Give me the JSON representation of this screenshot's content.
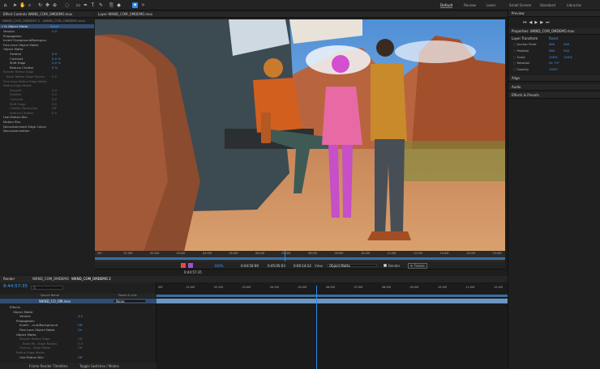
{
  "toolbar": {
    "workspaces": [
      "Default",
      "Review",
      "Learn",
      "Small Screen",
      "Standard",
      "Libraries"
    ],
    "active_workspace": "Default"
  },
  "effect_controls": {
    "tab_label": "Effect Controls WKND_COM_OMDEMO.mov",
    "layer_title": "WKND_COM_OMDEMO 2 - WKND_COM_OMDEMO.mov",
    "effect_name": "Object Matte",
    "reset": "Reset",
    "rows": [
      {
        "label": "Version",
        "value": "4.0"
      },
      {
        "label": "Propagation",
        "value": ""
      },
      {
        "label": "Invert Foreground/Backgrou",
        "value": ""
      },
      {
        "label": "Fine-tune Object Matte",
        "value": ""
      },
      {
        "label": "Object Matte",
        "value": ""
      },
      {
        "label": "Feather",
        "value": "0.0"
      },
      {
        "label": "Contrast",
        "value": "0.0 %"
      },
      {
        "label": "Shift Edge",
        "value": "0.0 %"
      },
      {
        "label": "Reduce Chatter",
        "value": "0 %"
      },
      {
        "label": "Render Refine Edge",
        "value": ""
      },
      {
        "label": "Base Refine Edge Radius",
        "value": "0.0"
      },
      {
        "label": "Fine-tune Refine Edge Matte",
        "value": ""
      },
      {
        "label": "Refine Edge Matte",
        "value": ""
      },
      {
        "label": "Smooth",
        "value": "0.0"
      },
      {
        "label": "Feather",
        "value": "0.0"
      },
      {
        "label": "Contrast",
        "value": "0.0"
      },
      {
        "label": "Shift Edge",
        "value": "0.0"
      },
      {
        "label": "Chatter Reduction",
        "value": "Off"
      },
      {
        "label": "Reduce Chatter",
        "value": "0.0"
      },
      {
        "label": "Use Motion Blur",
        "value": ""
      },
      {
        "label": "Motion Blur",
        "value": ""
      },
      {
        "label": "Decontaminate Edge Colors",
        "value": ""
      },
      {
        "label": "Decontamination",
        "value": ""
      }
    ]
  },
  "viewer": {
    "tab_label": "Layer WKND_COM_OMDEMO.mov",
    "ruler_ticks": [
      "00f",
      "01:00f",
      "02:00f",
      "03:00f",
      "04:00f",
      "05:00f",
      "06:00f",
      "07:00f",
      "08:00f",
      "09:00f",
      "10:00f",
      "11:00f",
      "12:00f",
      "13:00f",
      "14:00f",
      "15:00f"
    ],
    "timecodes": [
      "0:44:50:00",
      "0:45:05:03",
      "0:00:14:22"
    ],
    "view_label": "View:",
    "view_value": "Object Matte",
    "render_label": "Render",
    "freeze_label": "Freeze",
    "zoom": "100%",
    "current_time": "0:44:57:35"
  },
  "timeline": {
    "tabs": [
      "Render Queue",
      "WKND_COM_OMDEMO",
      "WKND_COM_OMDEMO 2"
    ],
    "current_time": "8:44:57:35",
    "search_placeholder": "Q",
    "ruler": [
      "00f",
      "01:00f",
      "02:00f",
      "03:00f",
      "04:00f",
      "05:00f",
      "06:00f",
      "07:00f",
      "08:00f",
      "09:00f",
      "10:00f",
      "11:00f",
      "12:00f"
    ],
    "col_source": "Source Name",
    "col_parent": "Parent & Link",
    "layer_name": "WKND_CO_OM.mov",
    "layer_parent": "None",
    "rows": [
      {
        "label": "Effects",
        "value": ""
      },
      {
        "label": "Object Matte",
        "value": ""
      },
      {
        "label": "Version",
        "value": "4.0"
      },
      {
        "label": "Propagation",
        "value": ""
      },
      {
        "label": "Invert ...und/Background",
        "value": "Off"
      },
      {
        "label": "Fine-tune Object Matte",
        "value": "On"
      },
      {
        "label": "Object Matte",
        "value": ""
      },
      {
        "label": "Render Refine Edge",
        "value": "Off"
      },
      {
        "label": "Base Re...Edge Radius",
        "value": "0.0"
      },
      {
        "label": "Fine-tu...Edge Matte",
        "value": "Off"
      },
      {
        "label": "Refine Edge Matte",
        "value": ""
      },
      {
        "label": "Use Motion Blur",
        "value": "Off"
      }
    ],
    "footer_left": "Frame Render Time",
    "footer_ms": "0ms",
    "footer_toggle": "Toggle Switches / Modes"
  },
  "right_panel": {
    "preview_label": "Preview",
    "properties_label": "Properties: WKND_COM_OMDEMO.mov",
    "layer_transform": "Layer Transform",
    "reset": "Reset",
    "props": [
      {
        "label": "Anchor Point",
        "v1": "960",
        "v2": "540"
      },
      {
        "label": "Position",
        "v1": "960",
        "v2": "540"
      },
      {
        "label": "Scale",
        "v1": "100%",
        "v2": "100%"
      },
      {
        "label": "Rotation",
        "v1": "0x +0°",
        "v2": ""
      },
      {
        "label": "Opacity",
        "v1": "100%",
        "v2": ""
      }
    ],
    "align_label": "Align",
    "audio_label": "Audio",
    "effects_label": "Effects & Presets"
  }
}
